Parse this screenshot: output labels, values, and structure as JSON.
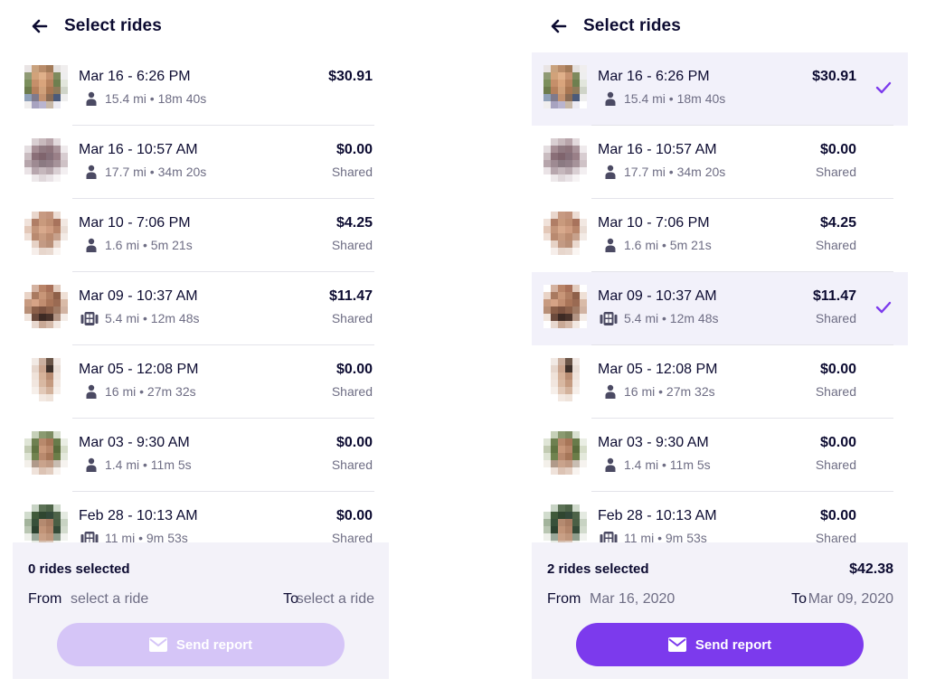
{
  "colors": {
    "primary": "#7c3aed",
    "primary_disabled": "#d5c5f7",
    "selected_row": "#f2f1fa",
    "footer_bg": "#f3f2f9",
    "text_dark": "#0c0b31",
    "text_muted": "#6e6d84"
  },
  "rides": [
    {
      "date": "Mar 16 - 6:26 PM",
      "mode": "person-icon",
      "stats": "15.4 mi • 18m 40s",
      "price": "$30.91",
      "shared": ""
    },
    {
      "date": "Mar 16 - 10:57 AM",
      "mode": "person-icon",
      "stats": "17.7 mi • 34m 20s",
      "price": "$0.00",
      "shared": "Shared"
    },
    {
      "date": "Mar 10 - 7:06 PM",
      "mode": "person-icon",
      "stats": "1.6 mi • 5m 21s",
      "price": "$4.25",
      "shared": "Shared"
    },
    {
      "date": "Mar 09 - 10:37 AM",
      "mode": "bus-icon",
      "stats": "5.4 mi • 12m 48s",
      "price": "$11.47",
      "shared": "Shared"
    },
    {
      "date": "Mar 05 - 12:08 PM",
      "mode": "person-icon",
      "stats": "16 mi • 27m 32s",
      "price": "$0.00",
      "shared": "Shared"
    },
    {
      "date": "Mar 03 - 9:30 AM",
      "mode": "person-icon",
      "stats": "1.4 mi • 11m 5s",
      "price": "$0.00",
      "shared": "Shared"
    },
    {
      "date": "Feb 28 - 10:13 AM",
      "mode": "bus-icon",
      "stats": "11 mi • 9m 53s",
      "price": "$0.00",
      "shared": "Shared"
    }
  ],
  "left": {
    "title": "Select rides",
    "selected_rows": [],
    "footer": {
      "count": "0 rides selected",
      "total": "",
      "from_label": "From",
      "from_value": "select a ride",
      "to_label": "To",
      "to_value": "select a ride",
      "button_label": "Send report",
      "button_state": "disabled"
    }
  },
  "right": {
    "title": "Select rides",
    "selected_rows": [
      0,
      3
    ],
    "footer": {
      "count": "2 rides selected",
      "total": "$42.38",
      "from_label": "From",
      "from_value": "Mar 16, 2020",
      "to_label": "To",
      "to_value": "Mar 09, 2020",
      "button_label": "Send report",
      "button_state": "enabled"
    }
  }
}
